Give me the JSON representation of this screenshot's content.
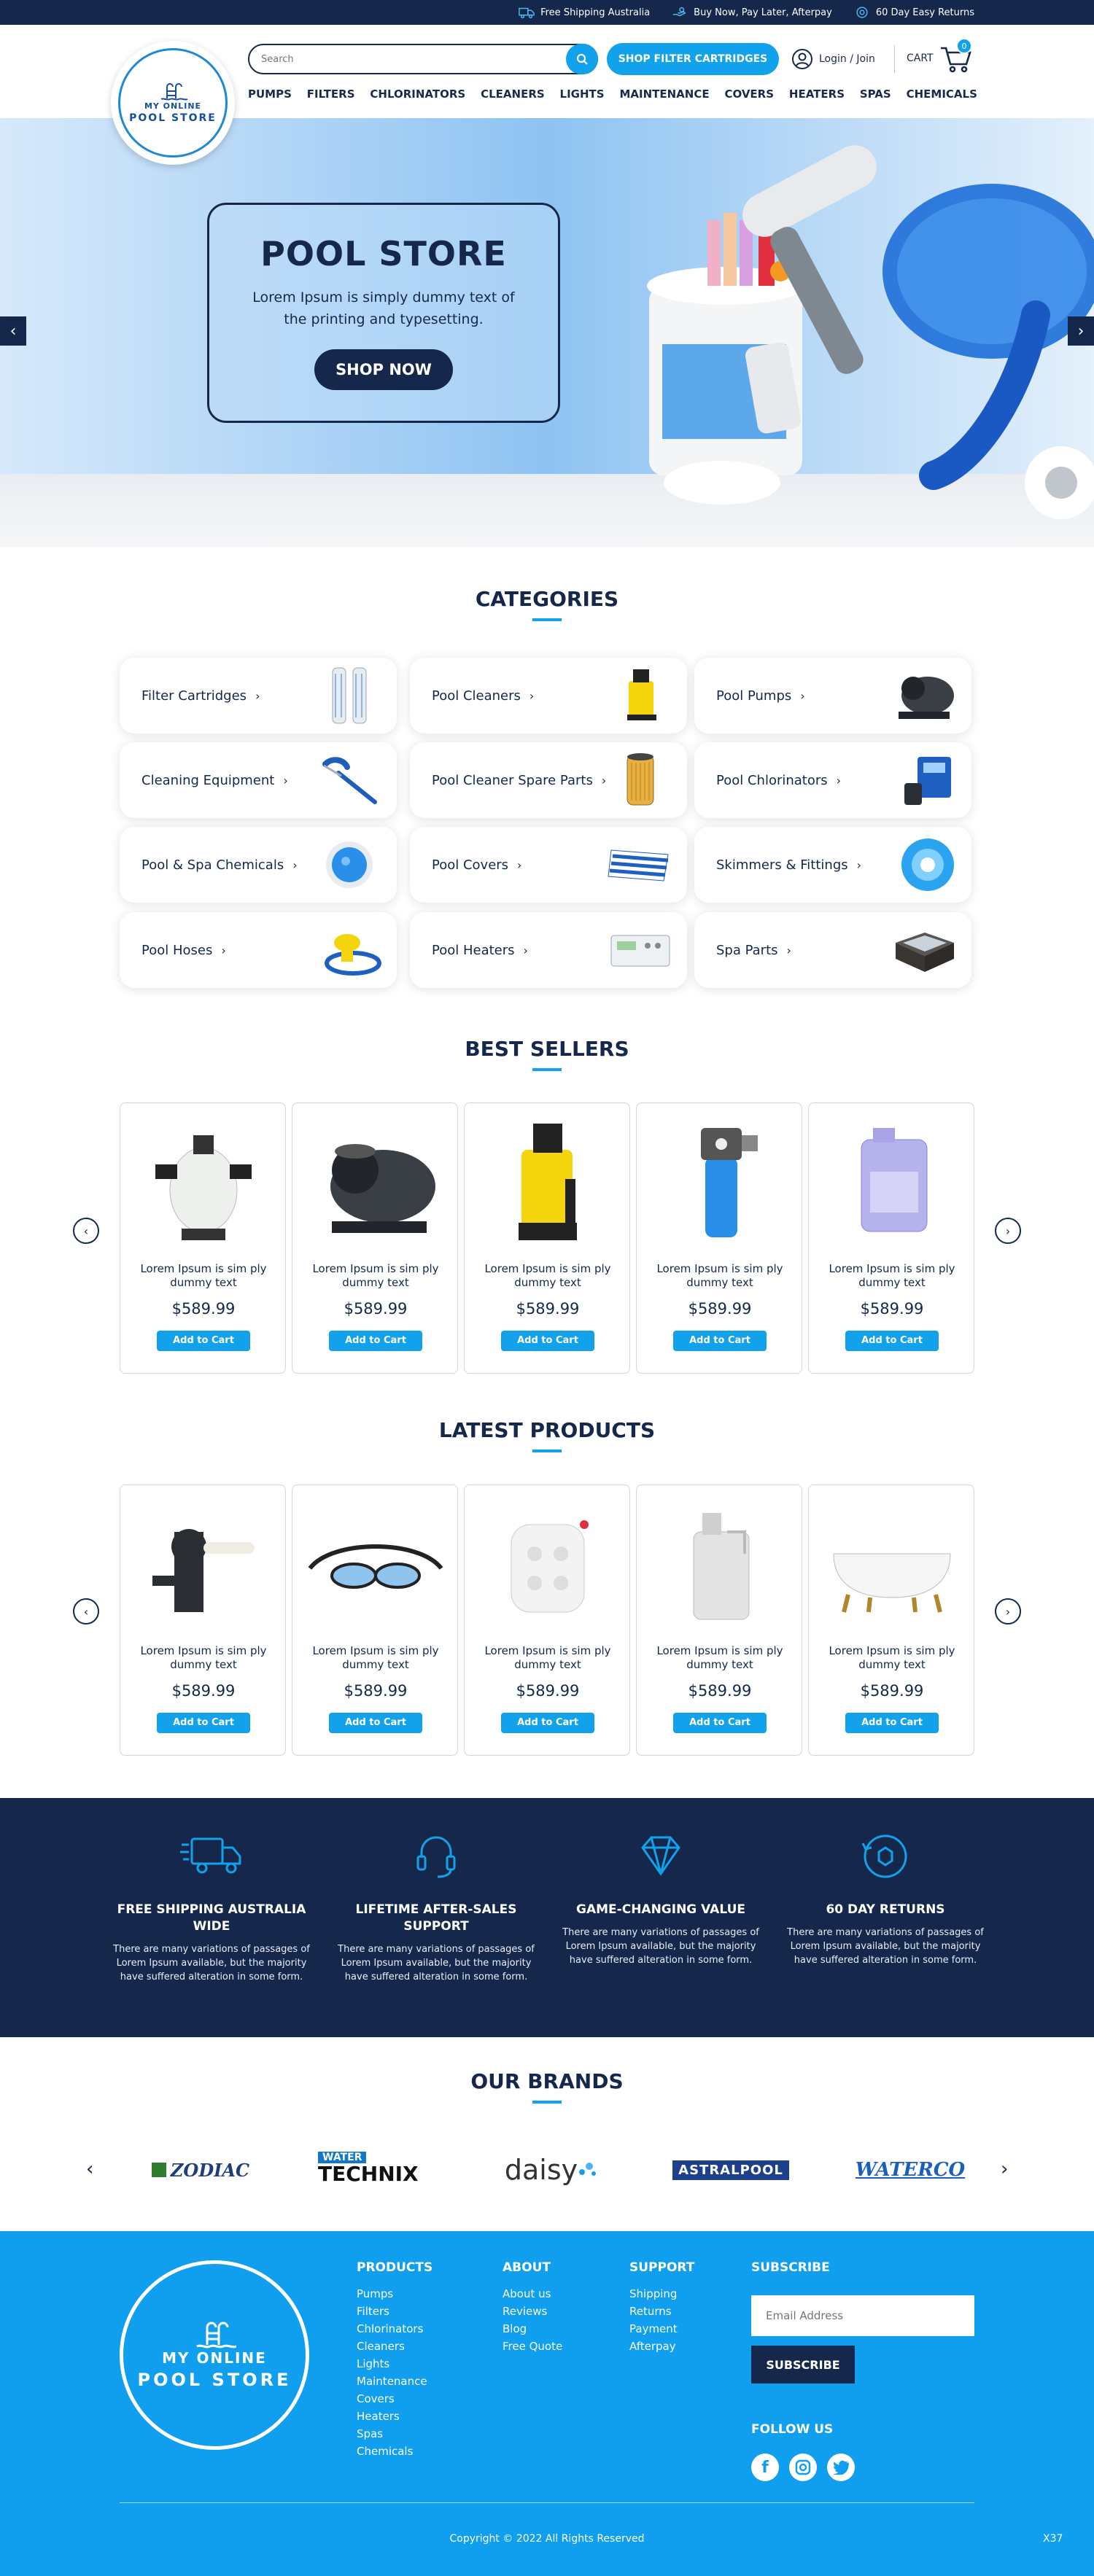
{
  "topbar": {
    "shipping": "Free Shipping Australia",
    "afterpay": "Buy Now, Pay Later, Afterpay",
    "returns": "60 Day Easy Returns"
  },
  "logo": {
    "line1": "MY ONLINE",
    "line2": "POOL STORE"
  },
  "search": {
    "placeholder": "Search"
  },
  "header": {
    "filter_button": "SHOP FILTER CARTRIDGES",
    "login": "Login / Join",
    "cart": "CART",
    "cart_count": "0"
  },
  "nav": [
    "PUMPS",
    "FILTERS",
    "CHLORINATORS",
    "CLEANERS",
    "LIGHTS",
    "MAINTENANCE",
    "COVERS",
    "HEATERS",
    "SPAS",
    "CHEMICALS"
  ],
  "hero": {
    "title": "POOL STORE",
    "text": "Lorem Ipsum is simply dummy text of the printing and typesetting.",
    "button": "SHOP NOW"
  },
  "categories": {
    "title": "CATEGORIES",
    "items": [
      "Filter Cartridges",
      "Pool Cleaners",
      "Pool Pumps",
      "Cleaning Equipment",
      "Pool Cleaner Spare Parts",
      "Pool Chlorinators",
      "Pool & Spa Chemicals",
      "Pool Covers",
      "Skimmers & Fittings",
      "Pool Hoses",
      "Pool Heaters",
      "Spa Parts"
    ]
  },
  "best_sellers": {
    "title": "BEST SELLERS",
    "products": [
      {
        "name": "Lorem Ipsum is sim ply dummy text",
        "price": "$589.99",
        "button": "Add to Cart"
      },
      {
        "name": "Lorem Ipsum is sim ply dummy text",
        "price": "$589.99",
        "button": "Add to Cart"
      },
      {
        "name": "Lorem Ipsum is sim ply dummy text",
        "price": "$589.99",
        "button": "Add to Cart"
      },
      {
        "name": "Lorem Ipsum is sim ply dummy text",
        "price": "$589.99",
        "button": "Add to Cart"
      },
      {
        "name": "Lorem Ipsum is sim ply dummy text",
        "price": "$589.99",
        "button": "Add to Cart"
      }
    ]
  },
  "latest_products": {
    "title": "LATEST PRODUCTS",
    "products": [
      {
        "name": "Lorem Ipsum is sim ply dummy text",
        "price": "$589.99",
        "button": "Add to Cart"
      },
      {
        "name": "Lorem Ipsum is sim ply dummy text",
        "price": "$589.99",
        "button": "Add to Cart"
      },
      {
        "name": "Lorem Ipsum is sim ply dummy text",
        "price": "$589.99",
        "button": "Add to Cart"
      },
      {
        "name": "Lorem Ipsum is sim ply dummy text",
        "price": "$589.99",
        "button": "Add to Cart"
      },
      {
        "name": "Lorem Ipsum is sim ply dummy text",
        "price": "$589.99",
        "button": "Add to Cart"
      }
    ]
  },
  "features": [
    {
      "title": "FREE SHIPPING AUSTRALIA WIDE",
      "text": "There are many variations of passages of Lorem Ipsum available, but the majority have suffered alteration in some form."
    },
    {
      "title": "LIFETIME AFTER-SALES SUPPORT",
      "text": "There are many variations of passages of Lorem Ipsum available, but the majority have suffered alteration in some form."
    },
    {
      "title": "GAME-CHANGING VALUE",
      "text": "There are many variations of passages of Lorem Ipsum available, but the majority have suffered alteration in some form."
    },
    {
      "title": "60 DAY RETURNS",
      "text": "There are many variations of passages of Lorem Ipsum available, but the majority have suffered alteration in some form."
    }
  ],
  "brands": {
    "title": "OUR BRANDS",
    "items": [
      "ZODIAC",
      "WATER",
      "TECHNIX",
      "daisy",
      "ASTRALPOOL",
      "WATERCO"
    ]
  },
  "footer": {
    "products": {
      "title": "PRODUCTS",
      "links": [
        "Pumps",
        "Filters",
        "Chlorinators",
        "Cleaners",
        "Lights",
        "Maintenance",
        "Covers",
        "Heaters",
        "Spas",
        "Chemicals"
      ]
    },
    "about": {
      "title": "ABOUT",
      "links": [
        "About us",
        "Reviews",
        "Blog",
        "Free Quote"
      ]
    },
    "support": {
      "title": "SUPPORT",
      "links": [
        "Shipping",
        "Returns",
        "Payment",
        "Afterpay"
      ]
    },
    "subscribe": {
      "title": "SUBSCRIBE",
      "placeholder": "Email Address",
      "button": "SUBSCRIBE"
    },
    "follow": "FOLLOW US",
    "copyright": "Copyright © 2022 All Rights Reserved",
    "code": "X37"
  },
  "colors": {
    "navy": "#15284b",
    "accent": "#12a1eb",
    "footer": "#0f9fee"
  }
}
